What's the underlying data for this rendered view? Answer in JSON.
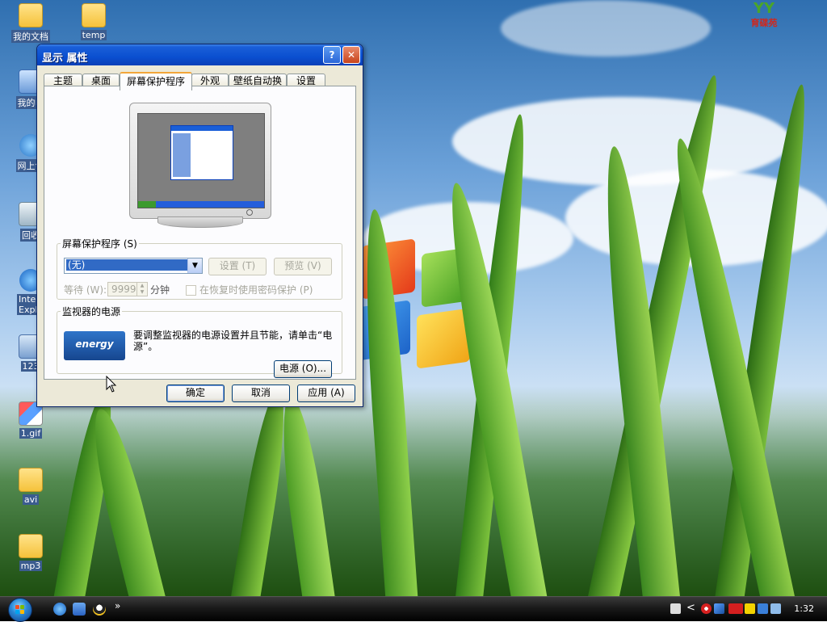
{
  "desktop": {
    "icons": [
      {
        "label": "我的文档"
      },
      {
        "label": "temp"
      },
      {
        "label": "我的电"
      },
      {
        "label": "网上邻"
      },
      {
        "label": "回收"
      },
      {
        "label": "Intern Explo"
      },
      {
        "label": "123"
      },
      {
        "label": "1.gif"
      },
      {
        "label": "avi"
      },
      {
        "label": "mp3"
      }
    ],
    "brand": {
      "top": "YY",
      "bottom": "育碟苑"
    }
  },
  "dialog": {
    "title": "显示 属性",
    "help_btn": "?",
    "close_btn": "✕",
    "tabs": [
      "主题",
      "桌面",
      "屏幕保护程序",
      "外观",
      "壁纸自动换",
      "设置"
    ],
    "screensaver": {
      "group_label": "屏幕保护程序 (S)",
      "selected": "(无)",
      "settings_btn": "设置 (T)",
      "preview_btn": "预览 (V)",
      "wait_label": "等待 (W):",
      "wait_value": "9999",
      "minutes": "分钟",
      "password_label": "在恢复时使用密码保护 (P)"
    },
    "power": {
      "group_label": "监视器的电源",
      "text": "要调整监视器的电源设置并且节能，请单击“电源”。",
      "power_btn": "电源 (O)...",
      "logo_text": "energy"
    },
    "buttons": {
      "ok": "确定",
      "cancel": "取消",
      "apply": "应用 (A)"
    }
  },
  "taskbar": {
    "clock": "1:32",
    "chevron": "»",
    "tray_chevron": "<"
  }
}
